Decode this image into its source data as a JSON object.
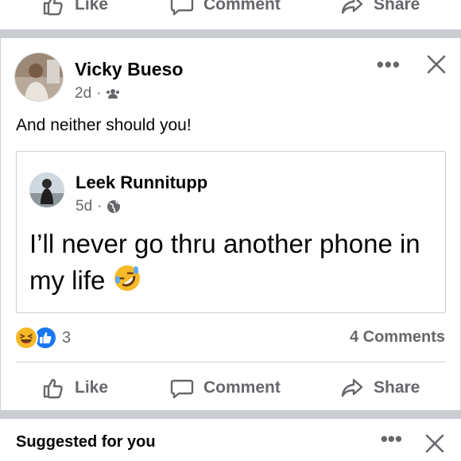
{
  "top_actions": {
    "like_label": "Like",
    "comment_label": "Comment",
    "share_label": "Share"
  },
  "post": {
    "author": "Vicky Bueso",
    "time": "2d",
    "privacy_icon": "friends-icon",
    "text": "And neither should you!",
    "shared": {
      "author": "Leek Runnitupp",
      "time": "5d",
      "privacy_icon": "globe-icon",
      "text": "I’ll never go thru another phone in my life"
    },
    "reactions": {
      "types": [
        "haha",
        "like"
      ],
      "count": "3"
    },
    "comments_count": "4 Comments"
  },
  "actions": {
    "like_label": "Like",
    "comment_label": "Comment",
    "share_label": "Share"
  },
  "suggested": {
    "title": "Suggested for you"
  },
  "colors": {
    "brand_blue": "#1877f2",
    "secondary_text": "#65676b",
    "divider": "#c9ccd1",
    "haha_yellow": "#f7b928"
  }
}
